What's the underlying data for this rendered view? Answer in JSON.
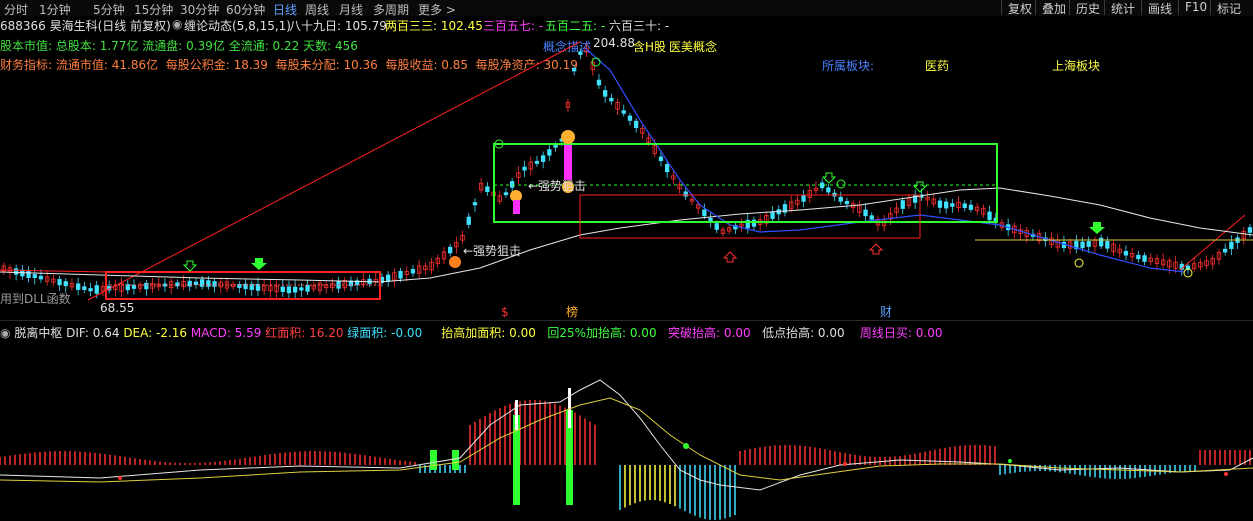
{
  "toolbar": {
    "periods": [
      "分时",
      "1分钟",
      "5分钟",
      "15分钟",
      "30分钟",
      "60分钟",
      "日线",
      "周线",
      "月线",
      "多周期",
      "更多 >"
    ],
    "active_period": "日线",
    "right_buttons": [
      "复权",
      "叠加",
      "历史",
      "统计",
      "画线",
      "F10",
      "标记"
    ]
  },
  "title_bar": {
    "stock": "688366 昊海生科(日线 前复权)",
    "indicator": "缠论动态(5,8,15,1)",
    "values": [
      {
        "label": "八十九日: 105.79",
        "color": "#e0e0e0"
      },
      {
        "label": "两百三三: 102.45",
        "color": "#ffff40"
      },
      {
        "label": "三百五七: -",
        "color": "#ff40ff"
      },
      {
        "label": "五百二五: -",
        "color": "#40ff40"
      },
      {
        "label": "六百三十: -",
        "color": "#e0e0e0"
      }
    ]
  },
  "capital_row": {
    "label": "股本市值:",
    "items": [
      "总股本: 1.77亿",
      "流通盘: 0.39亿",
      "全流通: 0.22",
      "天数: 456"
    ],
    "color": "#40e040"
  },
  "finance_row": {
    "label": "财务指标:",
    "items": [
      "流通市值: 41.86亿",
      "每股公积金: 18.39",
      "每股未分配: 10.36",
      "每股收益: 0.85",
      "每股净资产: 30.19"
    ],
    "color": "#ff7f40"
  },
  "concepts": {
    "header": "概念描述",
    "top_price": "204.88",
    "tags": [
      "含H股",
      "医美概念"
    ],
    "sector_label": "所属板块:",
    "sector": "医药",
    "region": "上海板块"
  },
  "annotations": {
    "strong_block_1": "←强势狙击",
    "strong_block_2": "←强势狙击",
    "low_price": "68.55",
    "dll_note": "用到DLL函数",
    "sig_s": "$",
    "sig_bang": "榜",
    "sig_cai": "财"
  },
  "macd_row": {
    "name": "脱离中枢",
    "values": [
      {
        "label": "DIF: 0.64",
        "color": "#e0e0e0"
      },
      {
        "label": "DEA: -2.16",
        "color": "#ffff40"
      },
      {
        "label": "MACD: 5.59",
        "color": "#ff40ff"
      },
      {
        "label": "红面积: 16.20",
        "color": "#ff4040"
      },
      {
        "label": "绿面积: -0.00",
        "color": "#40e0ff"
      },
      {
        "label": "抬高加面积: 0.00",
        "color": "#ffff40"
      },
      {
        "label": "回25%加抬高: 0.00",
        "color": "#40ff40"
      },
      {
        "label": "突破抬高: 0.00",
        "color": "#ff40ff"
      },
      {
        "label": "低点抬高: 0.00",
        "color": "#e0e0e0"
      },
      {
        "label": "周线日买: 0.00",
        "color": "#ff40ff"
      }
    ]
  },
  "colors": {
    "up": "#ff3030",
    "down": "#40e0ff",
    "box_green": "#30ff30",
    "box_red": "#ff2020",
    "ma_white": "#e8e8e8",
    "ma_blue": "#3050ff",
    "ma_yellow": "#e0d040"
  }
}
